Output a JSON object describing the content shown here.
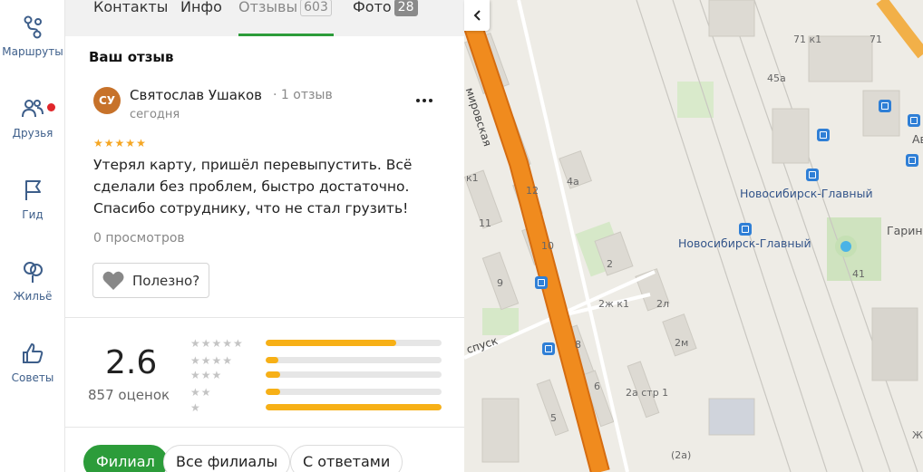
{
  "nav": [
    {
      "label": "Маршруты",
      "icon": "routes-icon"
    },
    {
      "label": "Друзья",
      "icon": "friends-icon"
    },
    {
      "label": "Гид",
      "icon": "guide-flag-icon"
    },
    {
      "label": "Жильё",
      "icon": "housing-icon"
    },
    {
      "label": "Советы",
      "icon": "thumbs-up-icon"
    }
  ],
  "tabs": {
    "contacts": "Контакты",
    "info": "Инфо",
    "reviews": "Отзывы",
    "reviews_count": "603",
    "photo": "Фото",
    "photo_count": "28"
  },
  "review": {
    "section_title": "Ваш отзыв",
    "avatar_initials": "СУ",
    "author": "Святослав Ушаков",
    "author_reviews": "1 отзыв",
    "date": "сегодня",
    "stars": 5,
    "text": "Утерял карту, пришёл перевыпустить. Всё сделали без проблем, быстро достаточно. Спасибо сотруднику, что не стал грузить!",
    "views": "0 просмотров",
    "useful_label": "Полезно?"
  },
  "rating": {
    "value": "2.6",
    "count_label": "857 оценок",
    "distribution": [
      {
        "stars": 5,
        "fraction": 0.74
      },
      {
        "stars": 4,
        "fraction": 0.07
      },
      {
        "stars": 3,
        "fraction": 0.08
      },
      {
        "stars": 2,
        "fraction": 0.08
      },
      {
        "stars": 1,
        "fraction": 1.0
      }
    ]
  },
  "filters": {
    "branch": "Филиал",
    "all_branches": "Все филиалы",
    "with_answers": "С ответами"
  },
  "map": {
    "station_label_1": "Новосибирск-Главный",
    "station_label_2": "Новосибирск-Главный",
    "street_1": "мировская",
    "street_2": "спуск",
    "avto": "Автоі",
    "garina": "Гарина",
    "buildings": [
      "71 к1",
      "71",
      "45а",
      "4а",
      "12",
      "11",
      "10",
      "9",
      "2",
      "2ж к1",
      "2л",
      "2м",
      "8",
      "6",
      "5",
      "2а стр 1",
      "(2а)",
      "41",
      "к1",
      "Ж"
    ]
  },
  "colors": {
    "accent": "#2c9c3a",
    "star": "#f5a623",
    "bar": "#f7b016",
    "avatar": "#c7722a",
    "road": "#f08b1e",
    "notification": "#e0262a"
  }
}
